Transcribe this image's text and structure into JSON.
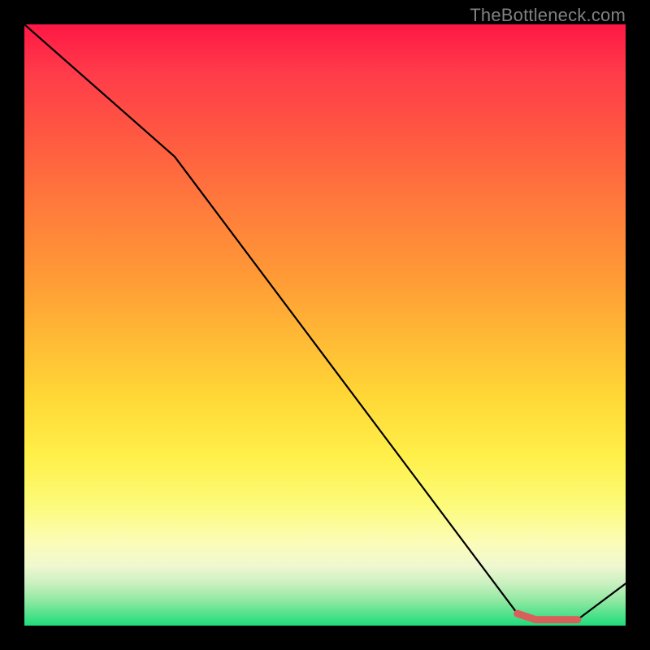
{
  "watermark": "TheBottleneck.com",
  "chart_data": {
    "type": "line",
    "title": "",
    "xlabel": "",
    "ylabel": "",
    "xlim": [
      0,
      100
    ],
    "ylim": [
      0,
      100
    ],
    "series": [
      {
        "name": "curve",
        "color": "#000000",
        "x": [
          0,
          25,
          82,
          85,
          92,
          100
        ],
        "values": [
          100,
          78,
          2,
          1,
          1,
          7
        ]
      },
      {
        "name": "highlight",
        "color": "#d9605a",
        "x": [
          82,
          85,
          92
        ],
        "values": [
          2,
          1,
          1
        ]
      }
    ]
  }
}
